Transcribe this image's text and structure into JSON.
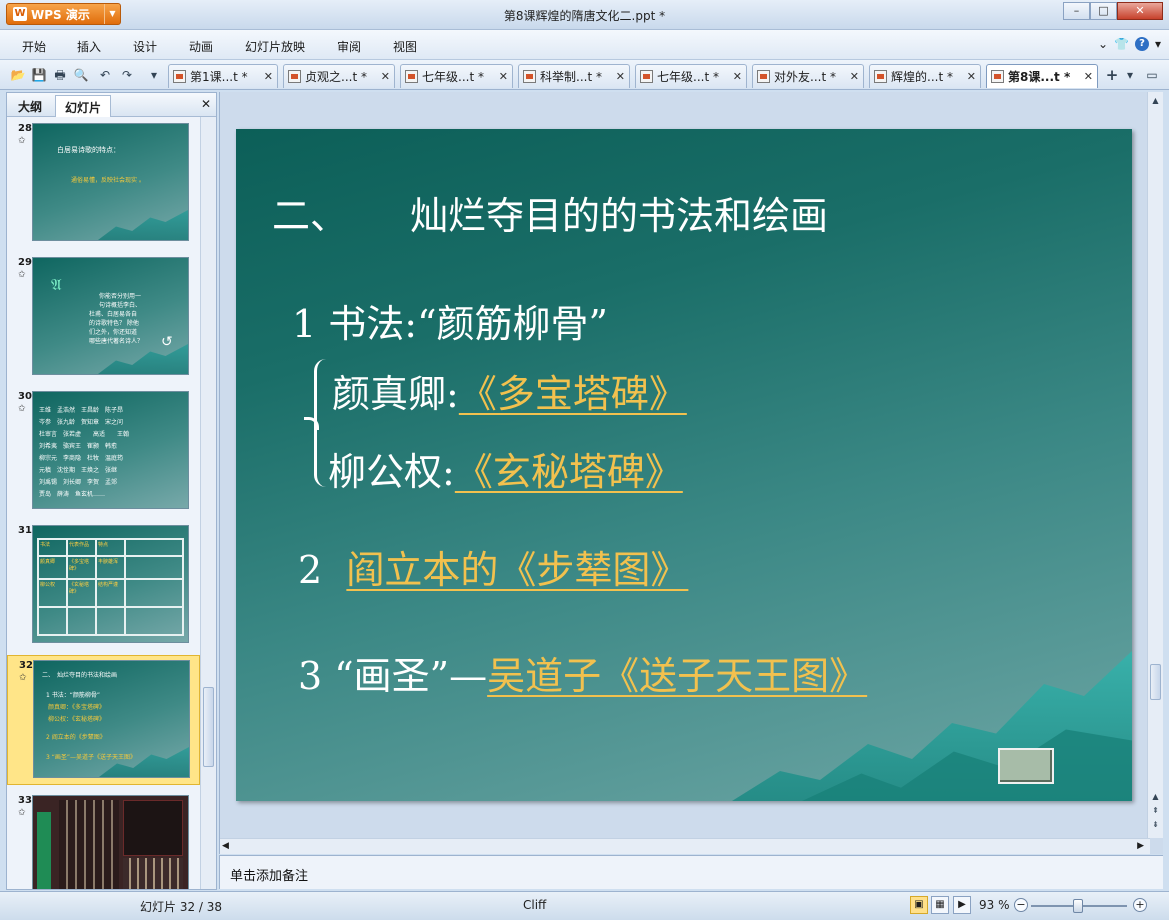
{
  "app": {
    "name": "WPS 演示",
    "logo": "W",
    "window_title": "第8课辉煌的隋唐文化二.ppt *"
  },
  "menu": [
    "开始",
    "插入",
    "设计",
    "动画",
    "幻灯片放映",
    "审阅",
    "视图"
  ],
  "tabs": [
    {
      "label": "第1课...t *"
    },
    {
      "label": "贞观之...t *"
    },
    {
      "label": "七年级...t *"
    },
    {
      "label": "科举制...t *"
    },
    {
      "label": "七年级...t *"
    },
    {
      "label": "对外友...t *"
    },
    {
      "label": "辉煌的...t *"
    },
    {
      "label": "第8课...t *",
      "active": true
    }
  ],
  "pane": {
    "tabs": [
      "大纲",
      "幻灯片"
    ],
    "active_tab": "幻灯片"
  },
  "thumbnails": [
    {
      "num": "28",
      "lines": [
        "白居易诗歌的特点：",
        "通俗易懂，反映社会现实 。"
      ]
    },
    {
      "num": "29",
      "lines": [
        "你能否分别用一",
        "句诗概括李白、",
        "杜甫、白居易各自",
        "的诗歌特色？ 除他",
        "们之外，你还知道",
        "哪些唐代著名诗人？"
      ]
    },
    {
      "num": "30",
      "lines": [
        "王维　孟浩然　王昌龄　陈子昂",
        "岑参　张九龄　贺知章　宋之问",
        "杜审言　张若虚　　高适　　王翰",
        "刘希夷　骆宾王　崔颢　韩愈",
        "柳宗元　李商隐　杜牧　温庭筠",
        "元稹　沈佺期　王焕之　张继",
        "刘禹锡　刘长卿　李贺　孟郊",
        "贾岛　薛涛　鱼玄机……"
      ]
    },
    {
      "num": "31",
      "cells": [
        "书法",
        "代表作品",
        "特点",
        "",
        "颜真卿",
        "《多宝塔碑》",
        "丰腴雄浑",
        "",
        "柳公权",
        "《玄秘塔碑》",
        "结构严谨",
        "",
        "",
        "",
        "",
        ""
      ]
    },
    {
      "num": "32",
      "selected": true,
      "lines": [
        "二、　灿烂夺目的书法和绘画",
        "1 书法：“颜筋柳骨”",
        "颜真卿：《多宝塔碑》",
        "柳公权：《玄秘塔碑》",
        "2 阎立本的《步辇图》",
        "3 “画圣”—吴道子《送子天王图》"
      ]
    },
    {
      "num": "33",
      "lines": []
    }
  ],
  "slide": {
    "title_num": "二、",
    "title_text": "灿烂夺目的的书法和绘画",
    "item1_prefix": "1  书法:",
    "item1_quote": "“颜筋柳骨”",
    "yan_label": "颜真卿:",
    "yan_link": "《多宝塔碑》",
    "liu_label": "柳公权:",
    "liu_link": "《玄秘塔碑》",
    "item2_num": "2",
    "item2_link": "阎立本的《步辇图》",
    "item3_prefix": "3  “画圣”—",
    "item3_link": "吴道子《送子天王图》"
  },
  "notes_placeholder": "单击添加备注",
  "status": {
    "slide_counter": "幻灯片 32 / 38",
    "theme": "Cliff",
    "zoom": "93 %",
    "zoom_level_percent": 93
  },
  "colors": {
    "link": "#f2c14e",
    "slide_bg": "#1a6e68",
    "accent": "#e06d0c"
  }
}
